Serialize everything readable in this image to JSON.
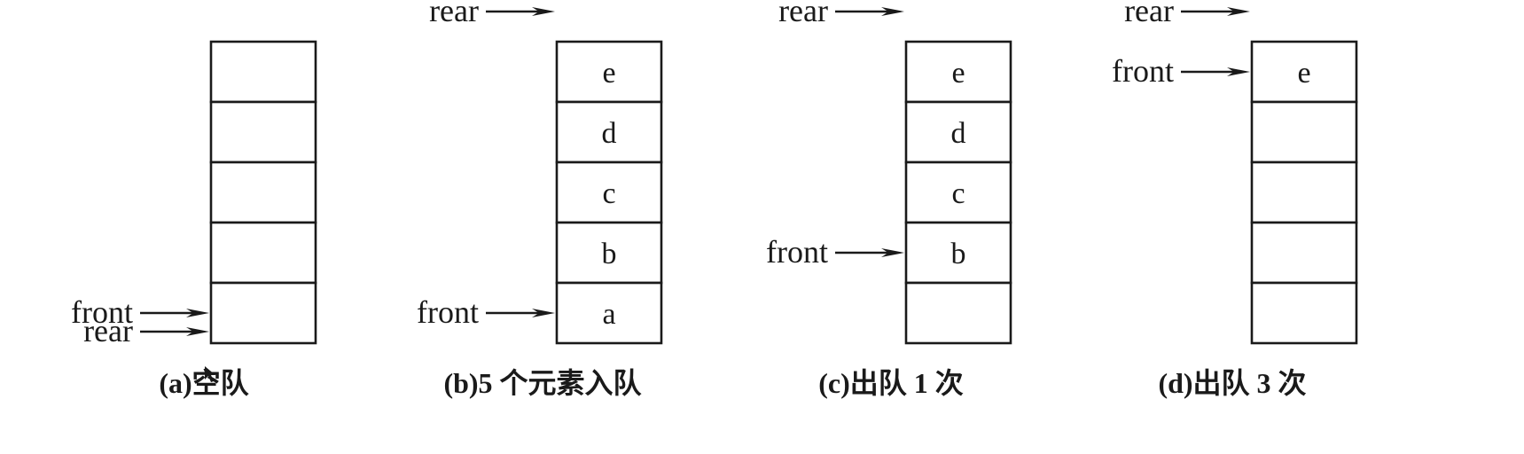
{
  "colors": {
    "ink": "#1a1a1a",
    "background": "#ffffff"
  },
  "panels": [
    {
      "caption": "(a)空队",
      "cells": [
        "",
        "",
        "",
        "",
        ""
      ],
      "pointers": [
        {
          "label": "front",
          "slot": 4.5
        },
        {
          "label": "rear",
          "slot": 5
        }
      ]
    },
    {
      "caption": "(b)5 个元素入队",
      "cells": [
        "e",
        "d",
        "c",
        "b",
        "a"
      ],
      "pointers": [
        {
          "label": "rear",
          "slot": -0.5
        },
        {
          "label": "front",
          "slot": 4.5
        }
      ]
    },
    {
      "caption": "(c)出队 1 次",
      "cells": [
        "e",
        "d",
        "c",
        "b",
        ""
      ],
      "pointers": [
        {
          "label": "rear",
          "slot": -0.5
        },
        {
          "label": "front",
          "slot": 3.5
        }
      ]
    },
    {
      "caption": "(d)出队 3 次",
      "cells": [
        "e",
        "",
        "",
        "",
        ""
      ],
      "pointers": [
        {
          "label": "rear",
          "slot": -0.5
        },
        {
          "label": "front",
          "slot": 0.5
        }
      ]
    }
  ]
}
